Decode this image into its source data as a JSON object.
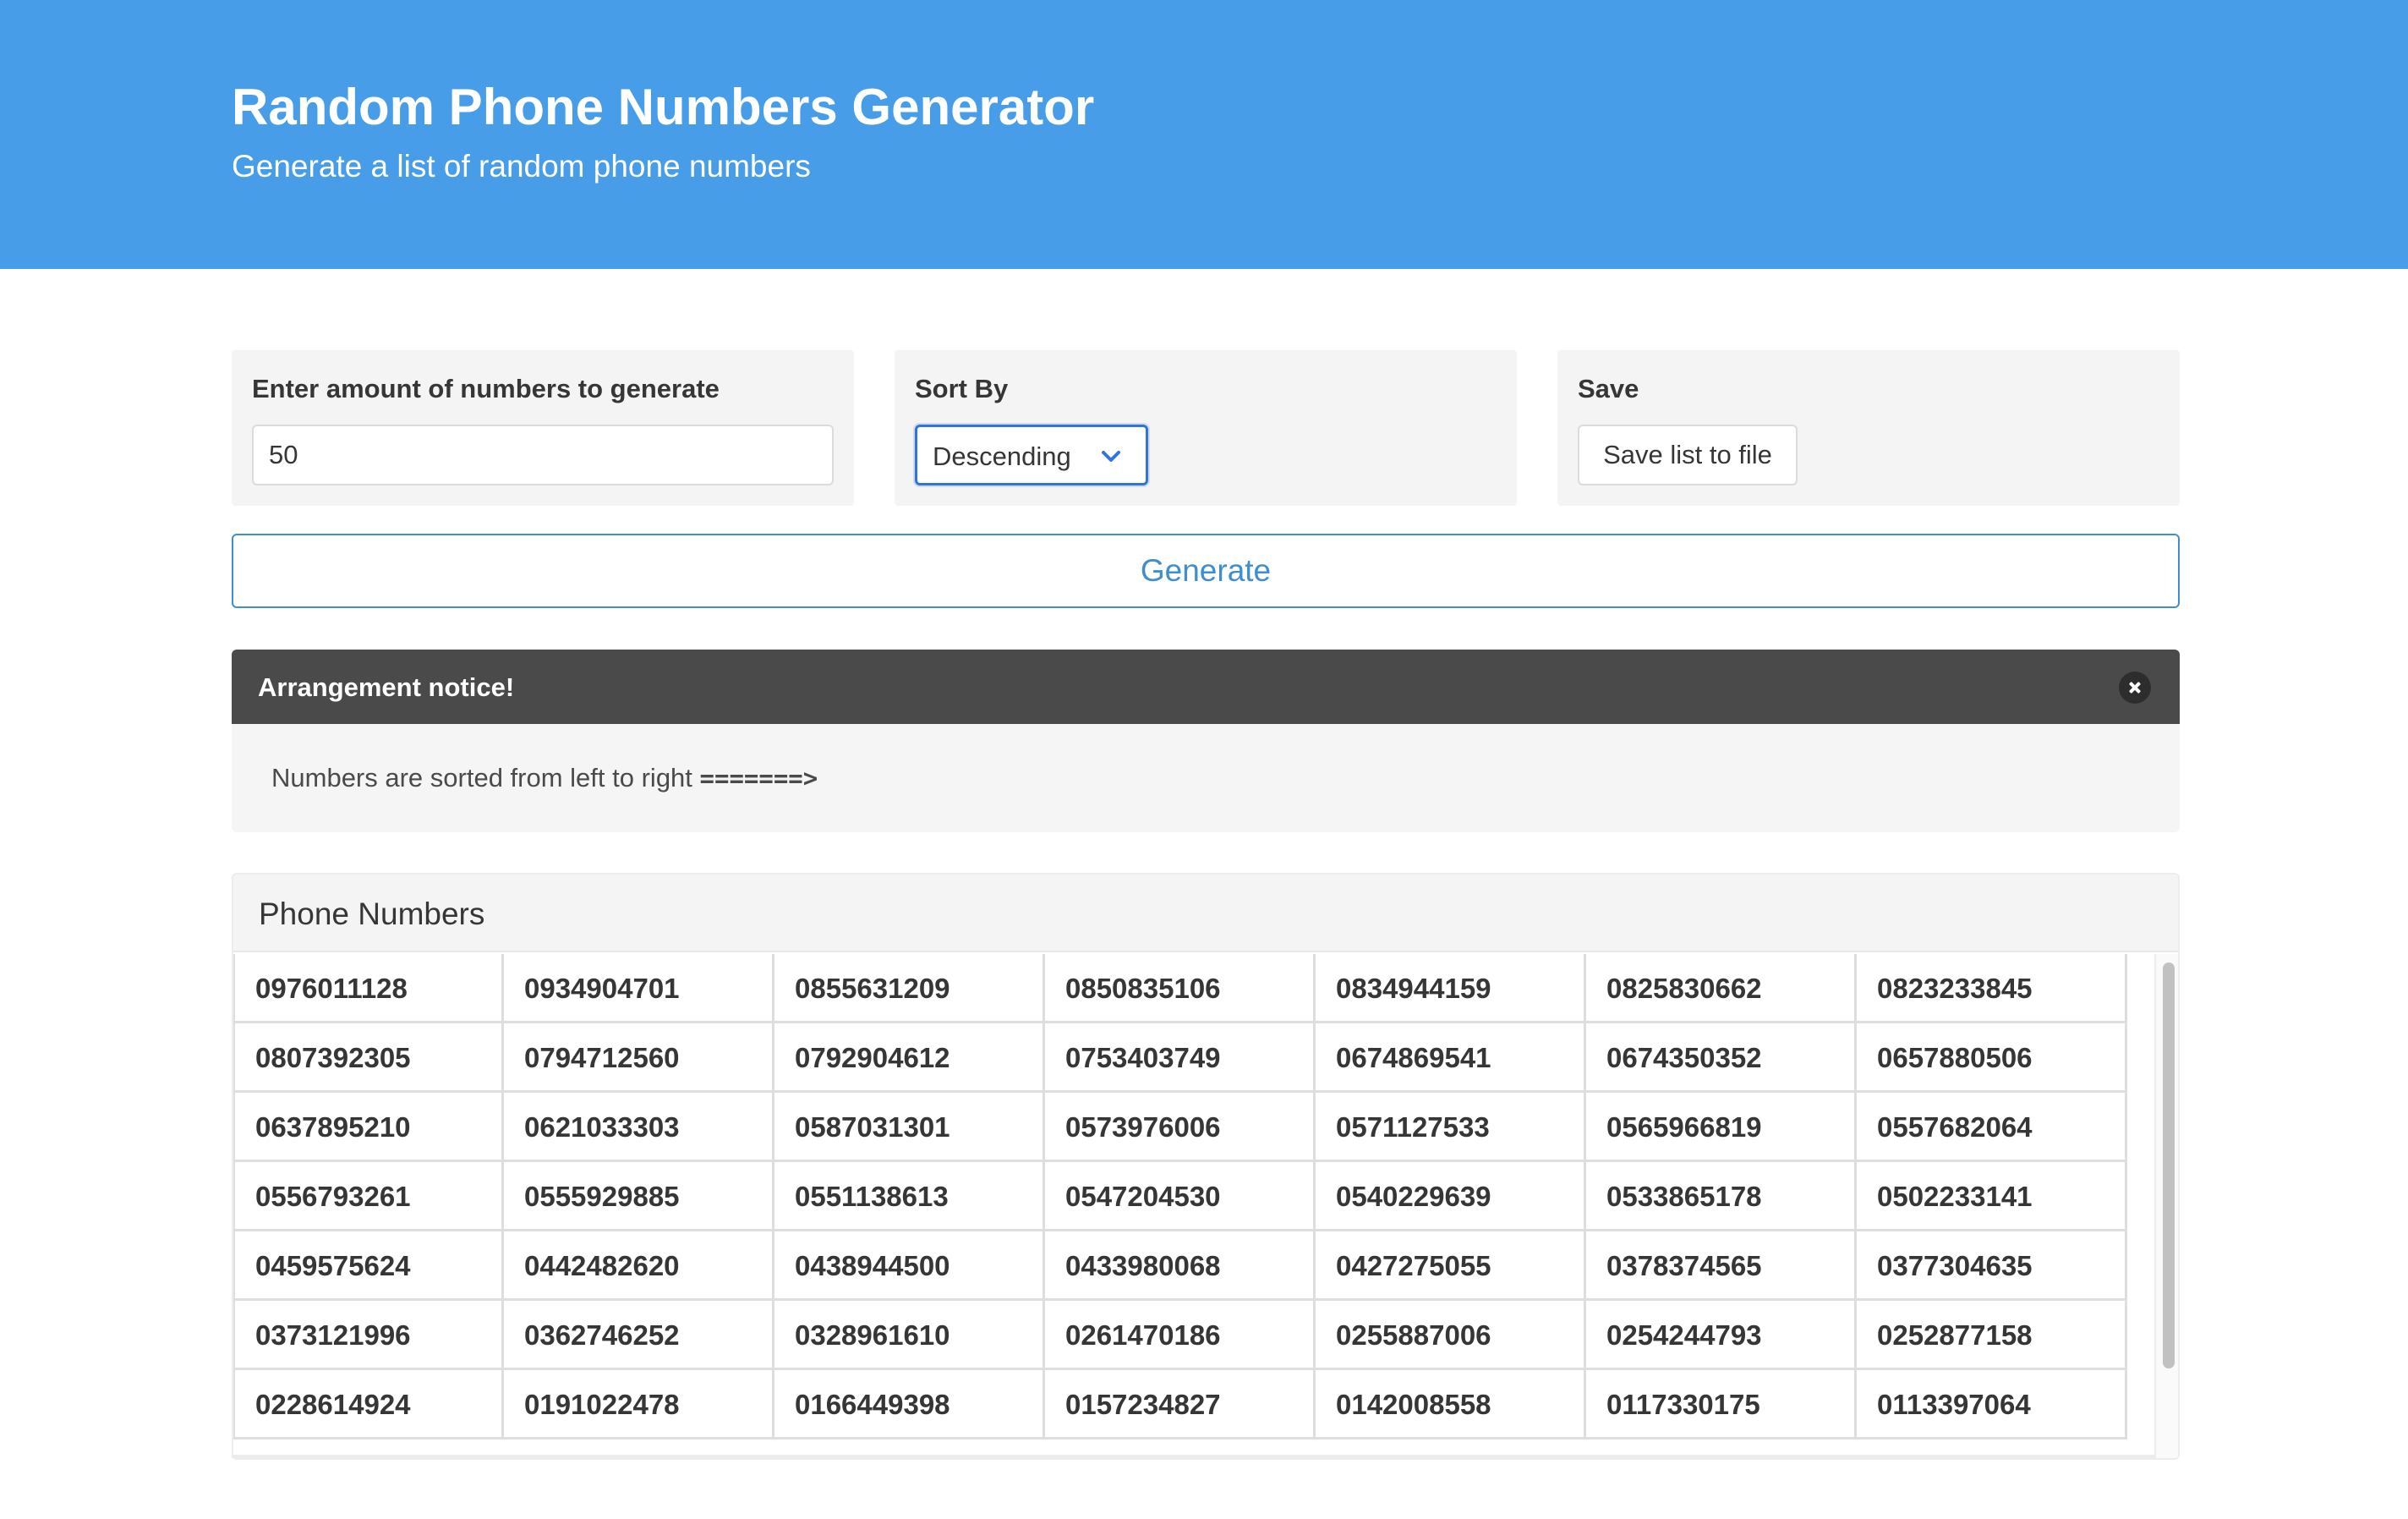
{
  "header": {
    "title": "Random Phone Numbers Generator",
    "subtitle": "Generate a list of random phone numbers"
  },
  "controls": {
    "amount": {
      "label": "Enter amount of numbers to generate",
      "value": "50"
    },
    "sort": {
      "label": "Sort By",
      "selected": "Descending",
      "icon": "chevron-down-icon"
    },
    "save": {
      "label": "Save",
      "button_label": "Save list to file"
    },
    "generate_label": "Generate"
  },
  "notice": {
    "title": "Arrangement notice!",
    "message": "Numbers are sorted from left to right",
    "arrow": "=======>",
    "close_icon": "close-icon"
  },
  "results": {
    "heading": "Phone Numbers",
    "numbers": [
      "0976011128",
      "0934904701",
      "0855631209",
      "0850835106",
      "0834944159",
      "0825830662",
      "0823233845",
      "0807392305",
      "0794712560",
      "0792904612",
      "0753403749",
      "0674869541",
      "0674350352",
      "0657880506",
      "0637895210",
      "0621033303",
      "0587031301",
      "0573976006",
      "0571127533",
      "0565966819",
      "0557682064",
      "0556793261",
      "0555929885",
      "0551138613",
      "0547204530",
      "0540229639",
      "0533865178",
      "0502233141",
      "0459575624",
      "0442482620",
      "0438944500",
      "0433980068",
      "0427275055",
      "0378374565",
      "0377304635",
      "0373121996",
      "0362746252",
      "0328961610",
      "0261470186",
      "0255887006",
      "0254244793",
      "0252877158",
      "0228614924",
      "0191022478",
      "0166449398",
      "0157234827",
      "0142008558",
      "0117330175",
      "0113397064"
    ]
  },
  "colors": {
    "hero": "#479de7",
    "accent": "#3e8ed0",
    "notice_header": "#4a4a4a",
    "card_bg": "#f4f4f4"
  }
}
